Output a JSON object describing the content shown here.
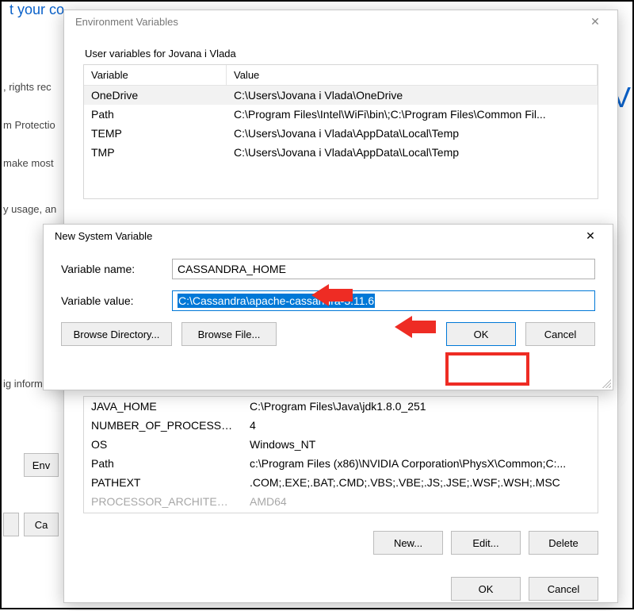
{
  "bg": {
    "top": "t your co",
    "left1": ", rights rec",
    "left2": "m Protectio",
    "left3": "make most",
    "left4": "y usage, an",
    "left5": "ig informa",
    "env_btn": "Env",
    "ca_btn": "Ca",
    "v": "V"
  },
  "envvars": {
    "title": "Environment Variables",
    "user_section": "User variables for Jovana i Vlada",
    "col_variable": "Variable",
    "col_value": "Value",
    "user_rows": [
      {
        "v": "OneDrive",
        "val": "C:\\Users\\Jovana i Vlada\\OneDrive"
      },
      {
        "v": "Path",
        "val": "C:\\Program Files\\Intel\\WiFi\\bin\\;C:\\Program Files\\Common Fil..."
      },
      {
        "v": "TEMP",
        "val": "C:\\Users\\Jovana i Vlada\\AppData\\Local\\Temp"
      },
      {
        "v": "TMP",
        "val": "C:\\Users\\Jovana i Vlada\\AppData\\Local\\Temp"
      }
    ],
    "sys_rows": [
      {
        "v": "JAVA_HOME",
        "val": "C:\\Program Files\\Java\\jdk1.8.0_251"
      },
      {
        "v": "NUMBER_OF_PROCESSORS",
        "val": "4"
      },
      {
        "v": "OS",
        "val": "Windows_NT"
      },
      {
        "v": "Path",
        "val": "c:\\Program Files (x86)\\NVIDIA Corporation\\PhysX\\Common;C:..."
      },
      {
        "v": "PATHEXT",
        "val": ".COM;.EXE;.BAT;.CMD;.VBS;.VBE;.JS;.JSE;.WSF;.WSH;.MSC"
      },
      {
        "v": "PROCESSOR_ARCHITECTU",
        "val": "AMD64"
      }
    ],
    "new_btn": "New...",
    "edit_btn": "Edit...",
    "delete_btn": "Delete",
    "ok_btn": "OK",
    "cancel_btn": "Cancel"
  },
  "newvar": {
    "title": "New System Variable",
    "name_label": "Variable name:",
    "value_label": "Variable value:",
    "name_value": "CASSANDRA_HOME",
    "value_value": "C:\\Cassandra\\apache-cassandra-3.11.6",
    "browse_dir": "Browse Directory...",
    "browse_file": "Browse File...",
    "ok": "OK",
    "cancel": "Cancel"
  }
}
